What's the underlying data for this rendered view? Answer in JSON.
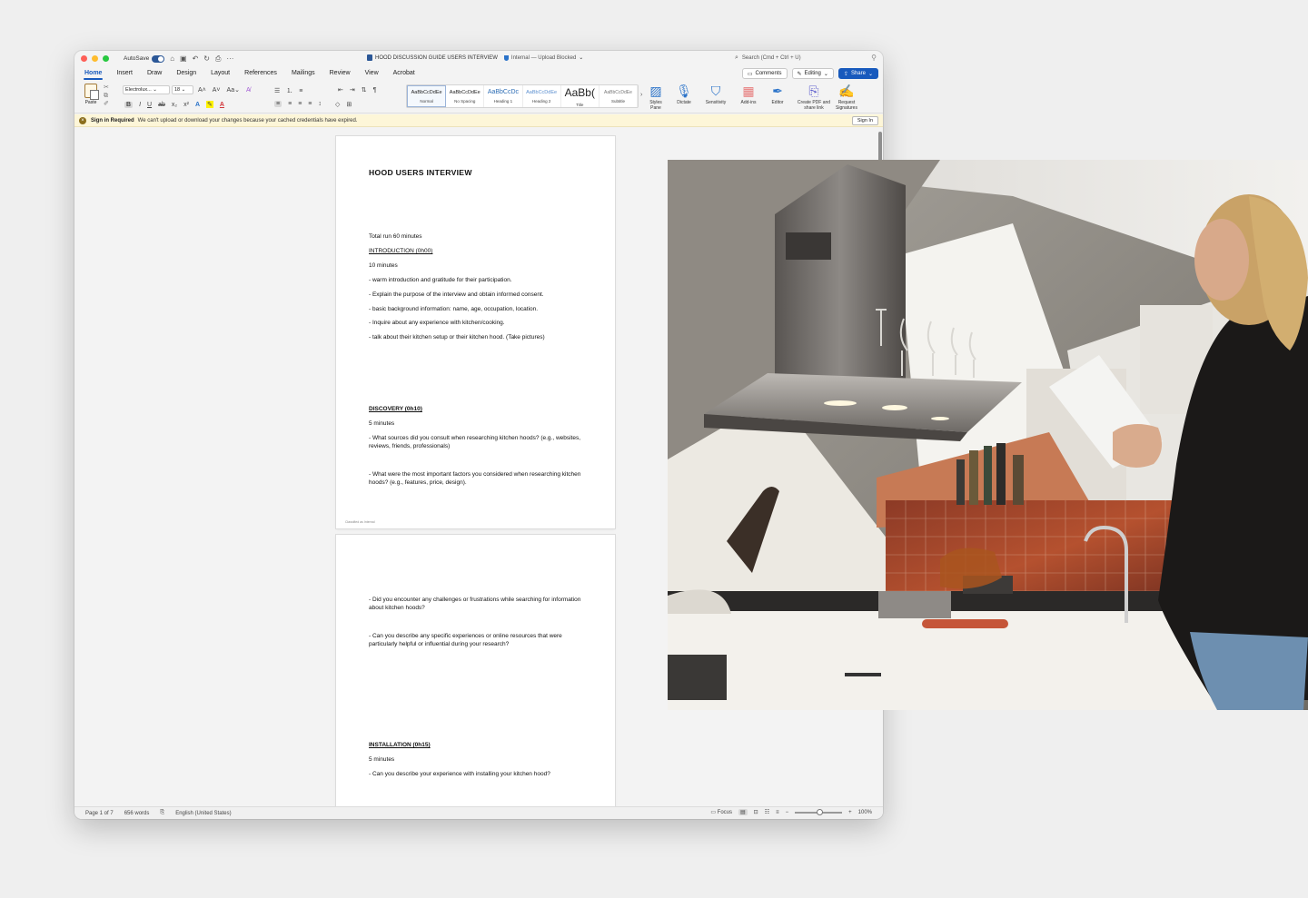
{
  "titlebar": {
    "autosave": "AutoSave",
    "doc_title": "HOOD DISCUSSION GUIDE USERS INTERVIEW",
    "status": "Internal — Upload Blocked",
    "search_placeholder": "Search (Cmd + Ctrl + U)"
  },
  "tabs": [
    "Home",
    "Insert",
    "Draw",
    "Design",
    "Layout",
    "References",
    "Mailings",
    "Review",
    "View",
    "Acrobat"
  ],
  "toolbar": {
    "comments": "Comments",
    "editing": "Editing",
    "share": "Share"
  },
  "ribbon": {
    "paste": "Paste",
    "font": "Electrolux...",
    "size": "18",
    "styles": [
      {
        "sample": "AaBbCcDdEe",
        "label": "Normal"
      },
      {
        "sample": "AaBbCcDdEe",
        "label": "No Spacing"
      },
      {
        "sample": "AaBbCcDc",
        "label": "Heading 1"
      },
      {
        "sample": "AaBbCcDdEe",
        "label": "Heading 2"
      },
      {
        "sample": "AaBb(",
        "label": "Title"
      },
      {
        "sample": "AaBbCcDdEe",
        "label": "Subtitle"
      }
    ],
    "styles_pane": "Styles Pane",
    "dictate": "Dictate",
    "sensitivity": "Sensitivity",
    "addins": "Add-ins",
    "editor": "Editor",
    "create_pdf": "Create PDF and share link",
    "request_sig": "Request Signatures"
  },
  "message": {
    "title": "Sign in Required",
    "text": "We can't upload or download your changes because your cached credentials have expired.",
    "button": "Sign In"
  },
  "page1": {
    "title": "HOOD USERS INTERVIEW",
    "total": "Total run 60 minutes",
    "intro_heading": "INTRODUCTION (0h00)",
    "intro_time": "10 minutes",
    "intro_items": [
      "- warm introduction and gratitude for their participation.",
      "- Explain the purpose of the interview and obtain informed consent.",
      "- basic background information: name, age, occupation, location.",
      "- Inquire about any experience with kitchen/cooking.",
      "- talk about their kitchen setup or their kitchen hood. (Take pictures)"
    ],
    "discovery_heading": "DISCOVERY (0h10)",
    "discovery_time": "5 minutes",
    "discovery_q1": "- What sources did you consult when researching kitchen hoods? (e.g., websites, reviews, friends, professionals)",
    "discovery_q2": "- What were the most important factors you considered when researching kitchen hoods? (e.g., features, price, design).",
    "footer": "Classified as Internal"
  },
  "page2": {
    "q3": "- Did you encounter any challenges or frustrations while searching for information about kitchen hoods?",
    "q4": "- Can you describe any specific experiences or online resources that were particularly helpful or influential during your research?",
    "install_heading": "INSTALLATION (0h15)",
    "install_time": "5 minutes",
    "install_q1": "- Can you describe your experience with installing your kitchen hood?"
  },
  "statusbar": {
    "page": "Page 1 of 7",
    "words": "656 words",
    "language": "English (United States)",
    "focus": "Focus",
    "zoom": "100%"
  },
  "colors": {
    "accent": "#185abd",
    "message_bg": "#fdf6d8"
  }
}
